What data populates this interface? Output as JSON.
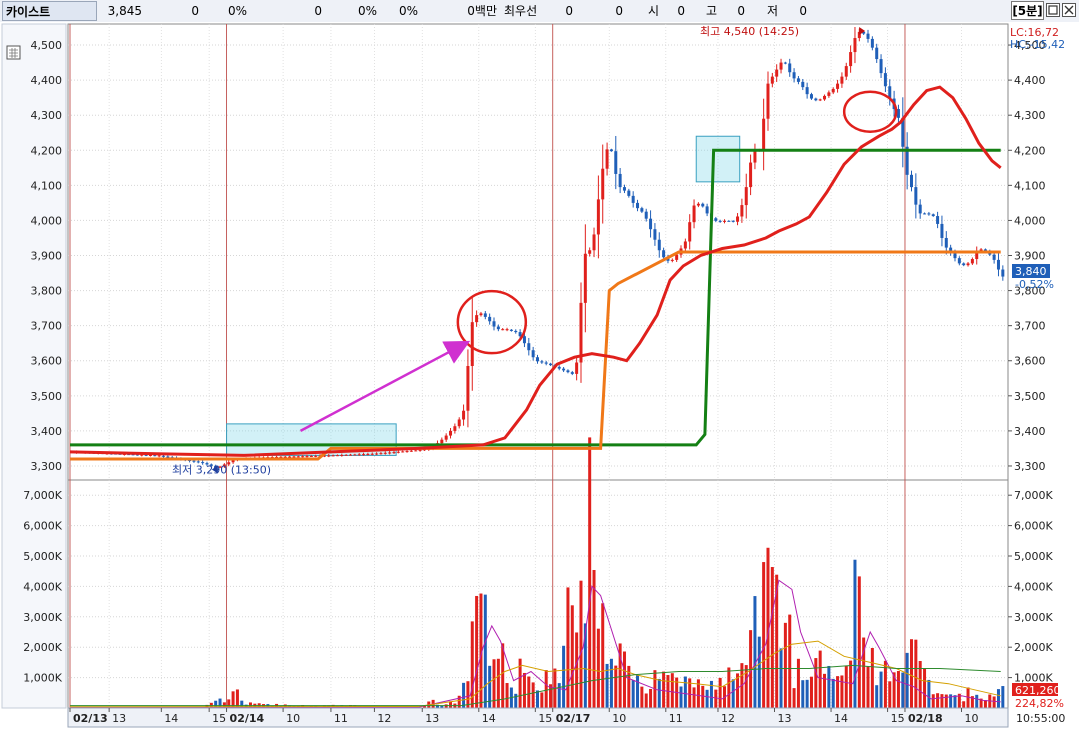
{
  "toolbar": {
    "name": "카이스트",
    "price": "3,845",
    "val1": "0",
    "pct1": "0%",
    "val2": "0",
    "pct2": "0%",
    "pct3": "0%",
    "amount_label": "0백만",
    "best_label": "최우선",
    "best_v1": "0",
    "best_v2": "0",
    "open_label": "시",
    "open_val": "0",
    "high_label": "고",
    "high_val": "0",
    "low_label": "저",
    "low_val": "0",
    "timeframe": "[5분]"
  },
  "colors": {
    "up": "#e0201c",
    "down": "#1f5fb8",
    "ma_red": "#e0201c",
    "green": "#148014",
    "orange": "#f07818",
    "magenta": "#d030d0",
    "box": "#7fd6e8"
  },
  "chart_data": [
    {
      "type": "line",
      "panel": "price",
      "y_ticks": [
        "4,500",
        "4,400",
        "4,300",
        "4,200",
        "4,100",
        "4,000",
        "3,900",
        "3,800",
        "3,700",
        "3,600",
        "3,500",
        "3,400",
        "3,300"
      ],
      "ylim": [
        3260,
        4560
      ],
      "x_labels": [
        "02/13",
        "13",
        "14",
        "15",
        "02/14",
        "10",
        "11",
        "12",
        "13",
        "14",
        "15",
        "02/17",
        "10",
        "11",
        "12",
        "13",
        "14",
        "15",
        "02/18",
        "10"
      ],
      "annotations": {
        "high": "최고 4,540 (14:25)",
        "low": "최저 3,290 (13:50)",
        "lc": "LC:16,72",
        "hc": "HC:-15,42",
        "last_price": "3,840",
        "last_change": "-0,52%"
      },
      "price_path": [
        [
          0,
          3340
        ],
        [
          10,
          3335
        ],
        [
          20,
          3330
        ],
        [
          30,
          3310
        ],
        [
          34,
          3295
        ],
        [
          38,
          3320
        ],
        [
          45,
          3325
        ],
        [
          60,
          3330
        ],
        [
          70,
          3335
        ],
        [
          75,
          3340
        ],
        [
          80,
          3345
        ],
        [
          83,
          3350
        ],
        [
          86,
          3380
        ],
        [
          89,
          3420
        ],
        [
          91,
          3470
        ],
        [
          92,
          3700
        ],
        [
          94,
          3740
        ],
        [
          96,
          3720
        ],
        [
          98,
          3690
        ],
        [
          100,
          3690
        ],
        [
          103,
          3680
        ],
        [
          105,
          3640
        ],
        [
          107,
          3600
        ],
        [
          110,
          3590
        ],
        [
          114,
          3570
        ],
        [
          116,
          3560
        ],
        [
          117,
          3630
        ],
        [
          118,
          3900
        ],
        [
          120,
          3920
        ],
        [
          121,
          4000
        ],
        [
          122,
          4120
        ],
        [
          124,
          4230
        ],
        [
          126,
          4100
        ],
        [
          128,
          4080
        ],
        [
          130,
          4040
        ],
        [
          132,
          4020
        ],
        [
          134,
          3960
        ],
        [
          136,
          3900
        ],
        [
          138,
          3880
        ],
        [
          140,
          3910
        ],
        [
          142,
          3950
        ],
        [
          143,
          4040
        ],
        [
          145,
          4050
        ],
        [
          147,
          4010
        ],
        [
          149,
          3995
        ],
        [
          151,
          4000
        ],
        [
          153,
          3995
        ],
        [
          155,
          4060
        ],
        [
          157,
          4200
        ],
        [
          159,
          4200
        ],
        [
          160,
          4380
        ],
        [
          162,
          4420
        ],
        [
          164,
          4460
        ],
        [
          166,
          4410
        ],
        [
          168,
          4390
        ],
        [
          170,
          4350
        ],
        [
          172,
          4340
        ],
        [
          174,
          4360
        ],
        [
          176,
          4380
        ],
        [
          178,
          4420
        ],
        [
          180,
          4500
        ],
        [
          181,
          4540
        ],
        [
          183,
          4530
        ],
        [
          185,
          4480
        ],
        [
          187,
          4400
        ],
        [
          189,
          4330
        ],
        [
          191,
          4280
        ],
        [
          192,
          4140
        ],
        [
          193,
          4120
        ],
        [
          195,
          4020
        ],
        [
          197,
          4020
        ],
        [
          199,
          4010
        ],
        [
          201,
          3930
        ],
        [
          203,
          3900
        ],
        [
          205,
          3870
        ],
        [
          207,
          3880
        ],
        [
          209,
          3920
        ],
        [
          211,
          3910
        ],
        [
          213,
          3880
        ],
        [
          214,
          3840
        ]
      ],
      "series": [
        {
          "values": [
            [
              0,
              3340
            ],
            [
              20,
              3335
            ],
            [
              40,
              3330
            ],
            [
              60,
              3340
            ],
            [
              80,
              3350
            ],
            [
              95,
              3360
            ],
            [
              100,
              3380
            ],
            [
              105,
              3460
            ],
            [
              108,
              3530
            ],
            [
              112,
              3590
            ],
            [
              116,
              3610
            ],
            [
              120,
              3620
            ],
            [
              125,
              3610
            ],
            [
              128,
              3600
            ],
            [
              131,
              3650
            ],
            [
              135,
              3730
            ],
            [
              138,
              3830
            ],
            [
              141,
              3870
            ],
            [
              145,
              3900
            ],
            [
              150,
              3920
            ],
            [
              155,
              3930
            ],
            [
              160,
              3950
            ],
            [
              163,
              3970
            ],
            [
              167,
              3990
            ],
            [
              170,
              4010
            ],
            [
              174,
              4080
            ],
            [
              178,
              4160
            ],
            [
              182,
              4210
            ],
            [
              186,
              4240
            ],
            [
              189,
              4260
            ],
            [
              191,
              4280
            ],
            [
              194,
              4330
            ],
            [
              197,
              4370
            ],
            [
              200,
              4380
            ],
            [
              203,
              4350
            ],
            [
              206,
              4290
            ],
            [
              209,
              4220
            ],
            [
              212,
              4170
            ],
            [
              214,
              4150
            ]
          ]
        },
        {
          "values": [
            [
              0,
              3360
            ],
            [
              100,
              3360
            ],
            [
              120,
              3360
            ],
            [
              141,
              3360
            ],
            [
              144,
              3360
            ],
            [
              146,
              3390
            ],
            [
              148,
              4200
            ],
            [
              150,
              4200
            ],
            [
              214,
              4200
            ]
          ]
        },
        {
          "values": [
            [
              0,
              3320
            ],
            [
              57,
              3320
            ],
            [
              60,
              3350
            ],
            [
              120,
              3350
            ],
            [
              122,
              3350
            ],
            [
              124,
              3800
            ],
            [
              126,
              3820
            ],
            [
              140,
              3910
            ],
            [
              214,
              3910
            ]
          ]
        }
      ]
    },
    {
      "type": "bar",
      "panel": "volume",
      "y_ticks": [
        "7,000K",
        "6,000K",
        "5,000K",
        "4,000K",
        "3,000K",
        "2,000K",
        "1,000K"
      ],
      "ylim": [
        0,
        7500
      ],
      "annotations": {
        "last_volume": "621,260",
        "last_ratio": "224,82%"
      },
      "bar_profile": [
        [
          0,
          30
        ],
        [
          30,
          20
        ],
        [
          38,
          550
        ],
        [
          40,
          200
        ],
        [
          45,
          120
        ],
        [
          80,
          40
        ],
        [
          82,
          300
        ],
        [
          85,
          200
        ],
        [
          86,
          200
        ],
        [
          88,
          150
        ],
        [
          90,
          800
        ],
        [
          92,
          2500
        ],
        [
          94,
          3900
        ],
        [
          96,
          3500
        ],
        [
          98,
          2500
        ],
        [
          100,
          1200
        ],
        [
          105,
          1400
        ],
        [
          110,
          1100
        ],
        [
          113,
          2000
        ],
        [
          116,
          6000
        ],
        [
          118,
          7400
        ],
        [
          120,
          6900
        ],
        [
          122,
          4600
        ],
        [
          124,
          3000
        ],
        [
          126,
          2200
        ],
        [
          128,
          1500
        ],
        [
          130,
          900
        ],
        [
          135,
          1100
        ],
        [
          140,
          1200
        ],
        [
          145,
          900
        ],
        [
          150,
          800
        ],
        [
          155,
          2700
        ],
        [
          157,
          3000
        ],
        [
          160,
          5900
        ],
        [
          162,
          4200
        ],
        [
          164,
          3200
        ],
        [
          166,
          1800
        ],
        [
          170,
          1900
        ],
        [
          175,
          1400
        ],
        [
          178,
          2200
        ],
        [
          180,
          4900
        ],
        [
          182,
          3000
        ],
        [
          184,
          2600
        ],
        [
          186,
          1600
        ],
        [
          190,
          1200
        ],
        [
          193,
          1900
        ],
        [
          195,
          1700
        ],
        [
          200,
          800
        ],
        [
          205,
          600
        ],
        [
          210,
          300
        ],
        [
          213,
          500
        ],
        [
          214,
          600
        ]
      ],
      "series": [
        {
          "values": [
            [
              0,
              20
            ],
            [
              80,
              20
            ],
            [
              92,
              400
            ],
            [
              95,
              2000
            ],
            [
              97,
              2700
            ],
            [
              99,
              2200
            ],
            [
              102,
              900
            ],
            [
              106,
              1200
            ],
            [
              110,
              700
            ],
            [
              114,
              600
            ],
            [
              118,
              2000
            ],
            [
              120,
              4000
            ],
            [
              122,
              3700
            ],
            [
              124,
              2800
            ],
            [
              128,
              1000
            ],
            [
              135,
              600
            ],
            [
              145,
              400
            ],
            [
              150,
              300
            ],
            [
              155,
              800
            ],
            [
              160,
              2100
            ],
            [
              163,
              4200
            ],
            [
              166,
              3900
            ],
            [
              168,
              2500
            ],
            [
              172,
              1000
            ],
            [
              176,
              900
            ],
            [
              180,
              800
            ],
            [
              184,
              2500
            ],
            [
              186,
              2000
            ],
            [
              190,
              900
            ],
            [
              194,
              700
            ],
            [
              198,
              300
            ],
            [
              205,
              400
            ],
            [
              210,
              250
            ],
            [
              214,
              200
            ]
          ]
        },
        {
          "values": [
            [
              0,
              40
            ],
            [
              80,
              50
            ],
            [
              92,
              300
            ],
            [
              96,
              800
            ],
            [
              100,
              1200
            ],
            [
              104,
              1400
            ],
            [
              110,
              1200
            ],
            [
              118,
              1300
            ],
            [
              122,
              1200
            ],
            [
              126,
              1300
            ],
            [
              130,
              1100
            ],
            [
              136,
              900
            ],
            [
              144,
              800
            ],
            [
              150,
              700
            ],
            [
              156,
              1200
            ],
            [
              162,
              1800
            ],
            [
              166,
              2100
            ],
            [
              172,
              2200
            ],
            [
              178,
              1700
            ],
            [
              184,
              1500
            ],
            [
              190,
              1300
            ],
            [
              196,
              900
            ],
            [
              202,
              800
            ],
            [
              208,
              600
            ],
            [
              214,
              400
            ]
          ]
        },
        {
          "values": [
            [
              0,
              80
            ],
            [
              90,
              80
            ],
            [
              100,
              300
            ],
            [
              110,
              600
            ],
            [
              120,
              900
            ],
            [
              130,
              1100
            ],
            [
              140,
              1200
            ],
            [
              150,
              1200
            ],
            [
              160,
              1300
            ],
            [
              170,
              1300
            ],
            [
              180,
              1400
            ],
            [
              190,
              1300
            ],
            [
              200,
              1300
            ],
            [
              214,
              1200
            ]
          ]
        }
      ]
    }
  ]
}
